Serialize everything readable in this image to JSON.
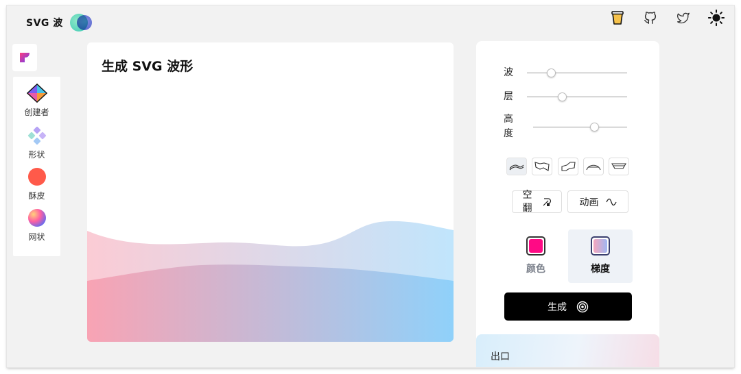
{
  "app": {
    "brand": "SVG 波"
  },
  "header": {
    "icons": [
      "coffee-cup-icon",
      "github-icon",
      "twitter-icon",
      "sun-icon"
    ]
  },
  "sidebar": {
    "items": [
      {
        "label": "创建者",
        "icon": "creator-cube-icon"
      },
      {
        "label": "形状",
        "icon": "shapes-icon"
      },
      {
        "label": "酥皮",
        "icon": "blob-icon",
        "color": "#ff5a4a"
      },
      {
        "label": "网状",
        "icon": "mesh-gradient-icon"
      }
    ]
  },
  "canvas": {
    "title": "生成 SVG 波形",
    "gradient_start": "#f8a1b2",
    "gradient_end": "#8dd0fa"
  },
  "controls": {
    "sliders": [
      {
        "label": "波",
        "value": 0.24
      },
      {
        "label": "层",
        "value": 0.35
      },
      {
        "label": "高度",
        "value": 0.65
      }
    ],
    "shape_buttons": [
      "wave-shape-icon",
      "wave-curve-icon",
      "wave-step-icon",
      "wave-peak-icon",
      "wave-flat-icon"
    ],
    "toggle_invert": "空翻",
    "toggle_animate": "动画",
    "color_options": [
      {
        "label": "颜色",
        "swatch": "#ff0a85"
      },
      {
        "label": "梯度",
        "swatch_from": "#f5a6bd",
        "swatch_to": "#9fb7f2"
      }
    ],
    "generate_label": "生成",
    "export_label": "出口"
  }
}
